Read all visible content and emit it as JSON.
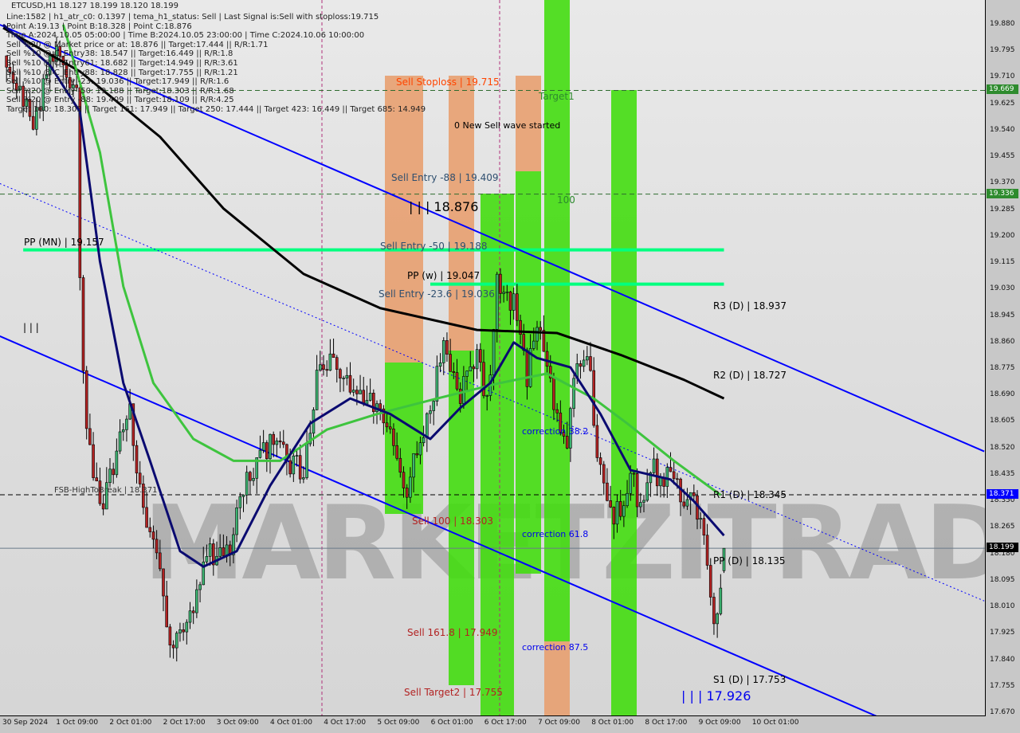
{
  "header": {
    "symbol_line": "ETCUSD,H1  18.127 18.199 18.120 18.199",
    "info_lines": [
      "Line:1582 | h1_atr_c0: 0.1397 | tema_h1_status: Sell | Last Signal is:Sell with stoploss:19.715",
      "Point A:19.13 | Point B:18.328 | Point C:18.876",
      "Time A:2024.10.05 05:00:00 | Time B:2024.10.05 23:00:00 | Time C:2024.10.06 10:00:00",
      "Sell %20 @ Market price or at: 18.876 || Target:17.444 || R/R:1.71",
      "Sell %10 @ C_Entry38: 18.547 || Target:16.449 || R/R:1.8",
      "Sell %10 @ C_Entry61: 18.682 || Target:14.949 || R/R:3.61",
      "Sell %10 @ C_Entry88: 18.828 || Target:17.755 || R/R:1.21",
      "Sell %10 @ Entry -23: 19.036 || Target:17.949 || R/R:1.6",
      "Sell %20 @ Entry -50: 19.188 || Target:18.303 || R/R:1.68",
      "Sell %20 @ Entry -88: 19.409 || Target:18.109 || R/R:4.25",
      "Target 100: 18.303 || Target 161: 17.949 || Target 250: 17.444 || Target 423: 16.449 || Target 685: 14.949"
    ]
  },
  "watermark": "MARKETZITRADE",
  "annotations": {
    "sell_stoploss": "Sell Stoploss | 19.715",
    "target1": "Target1",
    "new_wave": "0 New Sell wave started",
    "sell_entry_88": "Sell Entry -88 | 19.409",
    "point_c": "| | | 18.876",
    "level_100": "100",
    "pp_mn": "PP (MN) | 19.157",
    "sell_entry_50": "Sell Entry -50 | 19.188",
    "pp_w": "PP (w) | 19.047",
    "sell_entry_23": "Sell Entry -23.6 | 19.036",
    "triple_bar": "| | |",
    "fsb": "FSB-HighToBreak | 18.371",
    "correction_382": "correction 38.2",
    "sell_100": "Sell 100 | 18.303",
    "correction_618": "correction 61.8",
    "sell_1618": "Sell 161.8 | 17.949",
    "correction_875": "correction 87.5",
    "sell_target2": "Sell Target2 | 17.755",
    "r3": "R3 (D) | 18.937",
    "r2": "R2 (D) | 18.727",
    "r1": "R1 (D) | 18.345",
    "pp_d": "PP (D) | 18.135",
    "s1": "S1 (D) | 17.753",
    "point_b": "| | | 17.926"
  },
  "colors": {
    "bull": "#3cb371",
    "bear": "#b22222",
    "ma_slow": "#000000",
    "ma_mid": "#3ec43e",
    "ma_fast": "#0a0a70",
    "channel": "#0000ff",
    "pivot": "#00ff7f",
    "band_green": "#44dd11",
    "band_orange": "#e8a070"
  },
  "chart_data": {
    "type": "candlestick",
    "symbol": "ETCUSD",
    "timeframe": "H1",
    "ylim": [
      17.67,
      19.88
    ],
    "y_ticks": [
      "19.880",
      "19.795",
      "19.710",
      "19.625",
      "19.540",
      "19.455",
      "19.370",
      "19.285",
      "19.200",
      "19.115",
      "19.030",
      "18.945",
      "18.860",
      "18.775",
      "18.690",
      "18.605",
      "18.520",
      "18.435",
      "18.350",
      "18.265",
      "18.180",
      "18.095",
      "18.010",
      "17.925",
      "17.840",
      "17.755",
      "17.670"
    ],
    "x_ticks": [
      "30 Sep 2024",
      "1 Oct 09:00",
      "2 Oct 01:00",
      "2 Oct 17:00",
      "3 Oct 09:00",
      "4 Oct 01:00",
      "4 Oct 17:00",
      "5 Oct 09:00",
      "6 Oct 01:00",
      "6 Oct 17:00",
      "7 Oct 09:00",
      "8 Oct 01:00",
      "8 Oct 17:00",
      "9 Oct 09:00",
      "10 Oct 01:00"
    ],
    "price_badges": [
      {
        "value": "19.669",
        "color": "#2e8b2e"
      },
      {
        "value": "19.336",
        "color": "#2e8b2e"
      },
      {
        "value": "18.371",
        "color": "#0000ff"
      },
      {
        "value": "18.199",
        "color": "#000000"
      }
    ],
    "last": {
      "open": 18.127,
      "high": 18.199,
      "low": 18.12,
      "close": 18.199
    },
    "price_path": [
      [
        "2024-09-30 18:00",
        19.78
      ],
      [
        "2024-10-01 02:00",
        19.58
      ],
      [
        "2024-10-01 09:00",
        19.81
      ],
      [
        "2024-10-01 15:00",
        19.65
      ],
      [
        "2024-10-01 16:00",
        19.06
      ],
      [
        "2024-10-01 18:00",
        18.55
      ],
      [
        "2024-10-01 23:00",
        18.32
      ],
      [
        "2024-10-02 04:00",
        18.58
      ],
      [
        "2024-10-02 07:00",
        18.63
      ],
      [
        "2024-10-02 11:00",
        18.3
      ],
      [
        "2024-10-02 16:00",
        18.12
      ],
      [
        "2024-10-02 19:00",
        17.86
      ],
      [
        "2024-10-03 01:00",
        17.99
      ],
      [
        "2024-10-03 06:00",
        18.17
      ],
      [
        "2024-10-03 13:00",
        18.17
      ],
      [
        "2024-10-03 16:00",
        18.37
      ],
      [
        "2024-10-04 01:00",
        18.53
      ],
      [
        "2024-10-04 11:00",
        18.45
      ],
      [
        "2024-10-04 16:00",
        18.83
      ],
      [
        "2024-10-04 23:00",
        18.73
      ],
      [
        "2024-10-05 06:00",
        18.68
      ],
      [
        "2024-10-05 13:00",
        18.58
      ],
      [
        "2024-10-05 18:00",
        18.4
      ],
      [
        "2024-10-05 23:00",
        18.55
      ],
      [
        "2024-10-06 05:00",
        18.86
      ],
      [
        "2024-10-06 09:00",
        18.68
      ],
      [
        "2024-10-06 15:00",
        18.83
      ],
      [
        "2024-10-06 18:00",
        18.65
      ],
      [
        "2024-10-06 21:00",
        19.04
      ],
      [
        "2024-10-07 02:00",
        18.99
      ],
      [
        "2024-10-07 06:00",
        18.76
      ],
      [
        "2024-10-07 10:00",
        18.91
      ],
      [
        "2024-10-07 15:00",
        18.63
      ],
      [
        "2024-10-07 18:00",
        18.55
      ],
      [
        "2024-10-07 21:00",
        18.83
      ],
      [
        "2024-10-08 01:00",
        18.76
      ],
      [
        "2024-10-08 03:00",
        18.48
      ],
      [
        "2024-10-08 08:00",
        18.27
      ],
      [
        "2024-10-08 13:00",
        18.45
      ],
      [
        "2024-10-08 16:00",
        18.32
      ],
      [
        "2024-10-08 20:00",
        18.45
      ],
      [
        "2024-10-09 01:00",
        18.42
      ],
      [
        "2024-10-09 05:00",
        18.37
      ],
      [
        "2024-10-09 10:00",
        18.32
      ],
      [
        "2024-10-09 14:00",
        17.94
      ],
      [
        "2024-10-09 17:00",
        18.199
      ]
    ],
    "moving_averages": [
      {
        "color": "#000000",
        "points": [
          [
            "2024-09-30 17:00",
            19.87
          ],
          [
            "2024-10-01 16:00",
            19.73
          ],
          [
            "2024-10-02 16:00",
            19.52
          ],
          [
            "2024-10-03 11:00",
            19.29
          ],
          [
            "2024-10-04 11:00",
            19.08
          ],
          [
            "2024-10-05 10:00",
            18.97
          ],
          [
            "2024-10-06 15:00",
            18.9
          ],
          [
            "2024-10-07 15:00",
            18.89
          ],
          [
            "2024-10-08 10:00",
            18.82
          ],
          [
            "2024-10-09 05:00",
            18.74
          ],
          [
            "2024-10-09 17:00",
            18.68
          ]
        ]
      },
      {
        "color": "#3ec43e",
        "points": [
          [
            "2024-10-01 11:00",
            19.88
          ],
          [
            "2024-10-01 22:00",
            19.47
          ],
          [
            "2024-10-02 05:00",
            19.04
          ],
          [
            "2024-10-02 14:00",
            18.73
          ],
          [
            "2024-10-03 02:00",
            18.55
          ],
          [
            "2024-10-03 14:00",
            18.48
          ],
          [
            "2024-10-04 04:00",
            18.48
          ],
          [
            "2024-10-04 18:00",
            18.58
          ],
          [
            "2024-10-05 09:00",
            18.63
          ],
          [
            "2024-10-06 03:00",
            18.68
          ],
          [
            "2024-10-06 22:00",
            18.73
          ],
          [
            "2024-10-07 12:00",
            18.76
          ],
          [
            "2024-10-08 02:00",
            18.68
          ],
          [
            "2024-10-08 12:00",
            18.6
          ],
          [
            "2024-10-09 02:00",
            18.48
          ],
          [
            "2024-10-09 16:00",
            18.37
          ]
        ]
      },
      {
        "color": "#0a0a70",
        "points": [
          [
            "2024-09-30 17:00",
            19.88
          ],
          [
            "2024-10-01 07:00",
            19.75
          ],
          [
            "2024-10-01 16:00",
            19.6
          ],
          [
            "2024-10-01 22:00",
            19.12
          ],
          [
            "2024-10-02 05:00",
            18.73
          ],
          [
            "2024-10-02 13:00",
            18.48
          ],
          [
            "2024-10-02 22:00",
            18.19
          ],
          [
            "2024-10-03 05:00",
            18.14
          ],
          [
            "2024-10-03 15:00",
            18.19
          ],
          [
            "2024-10-04 01:00",
            18.4
          ],
          [
            "2024-10-04 13:00",
            18.6
          ],
          [
            "2024-10-05 01:00",
            18.68
          ],
          [
            "2024-10-05 13:00",
            18.63
          ],
          [
            "2024-10-06 01:00",
            18.55
          ],
          [
            "2024-10-06 10:00",
            18.65
          ],
          [
            "2024-10-06 19:00",
            18.73
          ],
          [
            "2024-10-07 02:00",
            18.86
          ],
          [
            "2024-10-07 09:00",
            18.81
          ],
          [
            "2024-10-07 19:00",
            18.78
          ],
          [
            "2024-10-08 04:00",
            18.63
          ],
          [
            "2024-10-08 13:00",
            18.45
          ],
          [
            "2024-10-09 01:00",
            18.42
          ],
          [
            "2024-10-09 08:00",
            18.35
          ],
          [
            "2024-10-09 17:00",
            18.24
          ]
        ]
      }
    ],
    "trendlines": [
      {
        "style": "solid",
        "points": [
          [
            "2024-09-30 16:00",
            19.88
          ],
          [
            "2024-10-12 23:00",
            18.51
          ]
        ]
      },
      {
        "style": "solid",
        "points": [
          [
            "2024-09-30 16:00",
            18.88
          ],
          [
            "2024-10-12 23:00",
            17.51
          ]
        ]
      },
      {
        "style": "dotted",
        "points": [
          [
            "2024-09-30 16:00",
            19.37
          ],
          [
            "2024-10-12 23:00",
            18.03
          ]
        ]
      }
    ],
    "levels": [
      {
        "price": 19.669,
        "style": "dashed",
        "color": "#2e6b2e"
      },
      {
        "price": 19.336,
        "style": "dashed",
        "color": "#2e6b2e"
      },
      {
        "price": 18.371,
        "style": "dashed",
        "color": "#000000"
      },
      {
        "price": 18.199,
        "style": "solid",
        "color": "#6a7a8a"
      },
      {
        "price": 19.157,
        "style": "pivot",
        "color": "#00ff7f",
        "from": "2024-09-30 23:00",
        "to": "2024-10-09 17:00"
      },
      {
        "price": 19.047,
        "style": "pivot",
        "color": "#00ff7f",
        "from": "2024-10-06 01:00",
        "to": "2024-10-09 17:00"
      }
    ]
  }
}
